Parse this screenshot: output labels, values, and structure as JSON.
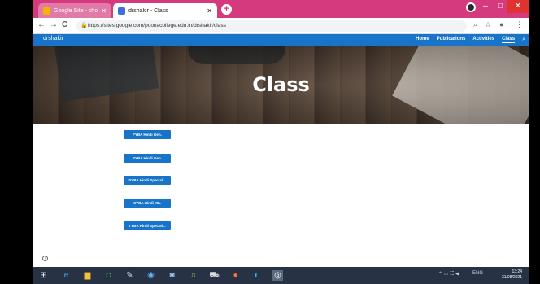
{
  "browser": {
    "tabs": [
      {
        "title": "Google Site - shoek.zoology@y...",
        "close": "✕"
      },
      {
        "title": "drshakir - Class",
        "close": "✕"
      }
    ],
    "new_tab": "+",
    "url": "https://sites.google.com/poonacollege.edu.in/drshakir/class",
    "window_controls": {
      "minimize": "–",
      "maximize": "□",
      "close": "✕"
    },
    "nav": {
      "back": "←",
      "forward": "→",
      "reload": "C"
    }
  },
  "site": {
    "name": "drshakir",
    "nav_items": [
      "Home",
      "Publications",
      "Activities",
      "Class"
    ],
    "active_nav": "Class",
    "page_title": "Class",
    "buttons": [
      "FYBA Hindi Gen.",
      "SYBA Hindi Gen.",
      "SYBA Hindi Special...",
      "SYBA Hindi MIL",
      "TYBA Hindi Special..."
    ]
  },
  "taskbar": {
    "tray_lang": "ENG",
    "time": "13:24",
    "date": "31/08/2021"
  },
  "colors": {
    "tab_strip": "#d53a7f",
    "site_blue": "#1874c8",
    "taskbar": "#283245"
  }
}
